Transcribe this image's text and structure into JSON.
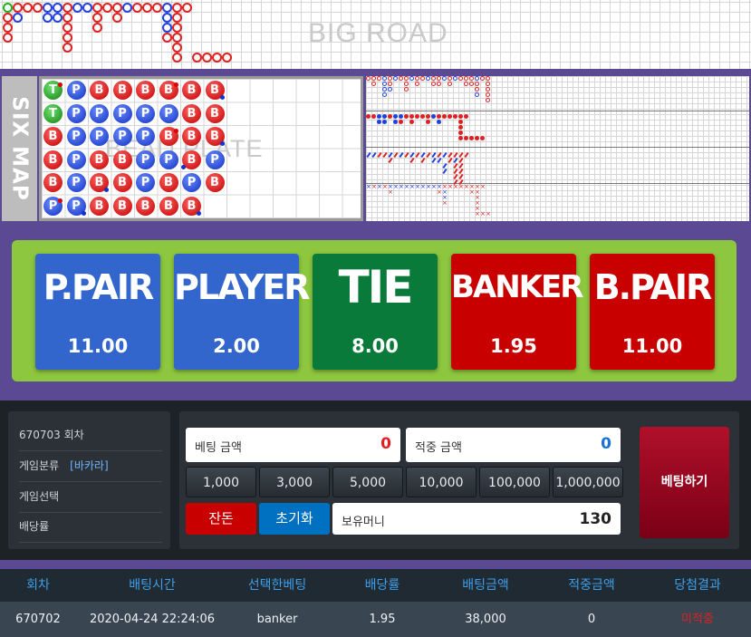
{
  "big_road": {
    "watermark": "BIG ROAD",
    "cols": [
      [
        "t",
        "b",
        "b",
        "b"
      ],
      [
        "b",
        "p"
      ],
      [
        "b"
      ],
      [
        "b"
      ],
      [
        "p",
        "p"
      ],
      [
        "p",
        "p"
      ],
      [
        "b",
        "b",
        "b",
        "b",
        "b"
      ],
      [
        "p"
      ],
      [
        "p"
      ],
      [
        "b",
        "b",
        "b"
      ],
      [
        "b"
      ],
      [
        "b",
        "b"
      ],
      [
        "p"
      ],
      [
        "b"
      ],
      [
        "b"
      ],
      [
        "b"
      ],
      [
        "p",
        "p",
        "p",
        "b"
      ],
      [
        "b",
        "b",
        "b",
        "b",
        "b",
        "b"
      ],
      [
        "b"
      ]
    ],
    "tail": [
      "b",
      "b",
      "b",
      "b"
    ]
  },
  "six_map": {
    "label": "SIX MAP",
    "watermark": "BEAD PLATE",
    "columns": [
      [
        "T",
        "T",
        "B",
        "B",
        "B",
        "P"
      ],
      [
        "P",
        "P",
        "P",
        "P",
        "P",
        "P"
      ],
      [
        "B",
        "P",
        "P",
        "B",
        "B",
        "B"
      ],
      [
        "B",
        "P",
        "P",
        "B",
        "B",
        "B"
      ],
      [
        "B",
        "P",
        "P",
        "P",
        "P",
        "B"
      ],
      [
        "B",
        "P",
        "B",
        "P",
        "B",
        "B"
      ],
      [
        "B",
        "B",
        "B",
        "B",
        "P",
        "B"
      ],
      [
        "B",
        "B",
        "B",
        "P",
        "B",
        ""
      ]
    ]
  },
  "bets": [
    {
      "name": "P.PAIR",
      "odds": "11.00",
      "color": "#3366cc"
    },
    {
      "name": "PLAYER",
      "odds": "2.00",
      "color": "#3366cc"
    },
    {
      "name": "TIE",
      "odds": "8.00",
      "color": "#0a7a3a"
    },
    {
      "name": "BANKER",
      "odds": "1.95",
      "color": "#c80000"
    },
    {
      "name": "B.PAIR",
      "odds": "11.00",
      "color": "#c80000"
    }
  ],
  "info": {
    "round": "670703 회차",
    "category_label": "게임분류",
    "category_value": "[바카라]",
    "selection_label": "게임선택",
    "odds_label": "배당률"
  },
  "betform": {
    "bet_amount_label": "베팅 금액",
    "bet_amount_value": "0",
    "win_amount_label": "적중 금액",
    "win_amount_value": "0",
    "chips": [
      "1,000",
      "3,000",
      "5,000",
      "10,000",
      "100,000",
      "1,000,000"
    ],
    "cancel_label": "잔돈",
    "reset_label": "초기화",
    "balance_label": "보유머니",
    "balance_value": "130",
    "place_label": "베팅하기"
  },
  "history": {
    "headers": [
      "회차",
      "배팅시간",
      "선택한베팅",
      "배당률",
      "배팅금액",
      "적중금액",
      "당첨결과"
    ],
    "rows": [
      [
        "670702",
        "2020-04-24 22:24:06",
        "banker",
        "1.95",
        "38,000",
        "0",
        "미적중"
      ]
    ]
  },
  "colors": {
    "banker": "#c80000",
    "player": "#3366cc",
    "tie": "#0a7a3a",
    "frame": "#5b4a93",
    "accent_green": "#8dc63f"
  }
}
